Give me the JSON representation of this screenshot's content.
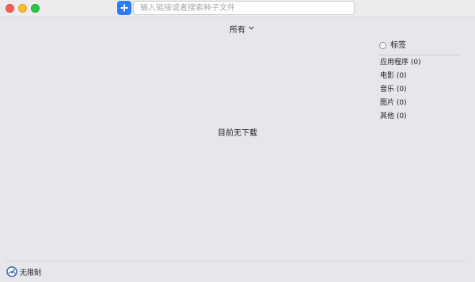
{
  "toolbar": {
    "add_icon": "plus-icon",
    "search_placeholder": "输入链接或者搜索种子文件",
    "search_value": "",
    "accent_color": "#2d7cf6"
  },
  "filter": {
    "label": "所有",
    "icon": "chevron-down-icon"
  },
  "tags": {
    "title": "标签",
    "items": [
      {
        "label": "应用程序 (0)"
      },
      {
        "label": "电影 (0)"
      },
      {
        "label": "音乐 (0)"
      },
      {
        "label": "图片 (0)"
      },
      {
        "label": "其他 (0)"
      }
    ]
  },
  "main": {
    "empty_message": "目前无下载"
  },
  "statusbar": {
    "speed_icon": "speedometer-icon",
    "speed_label": "无限制"
  }
}
